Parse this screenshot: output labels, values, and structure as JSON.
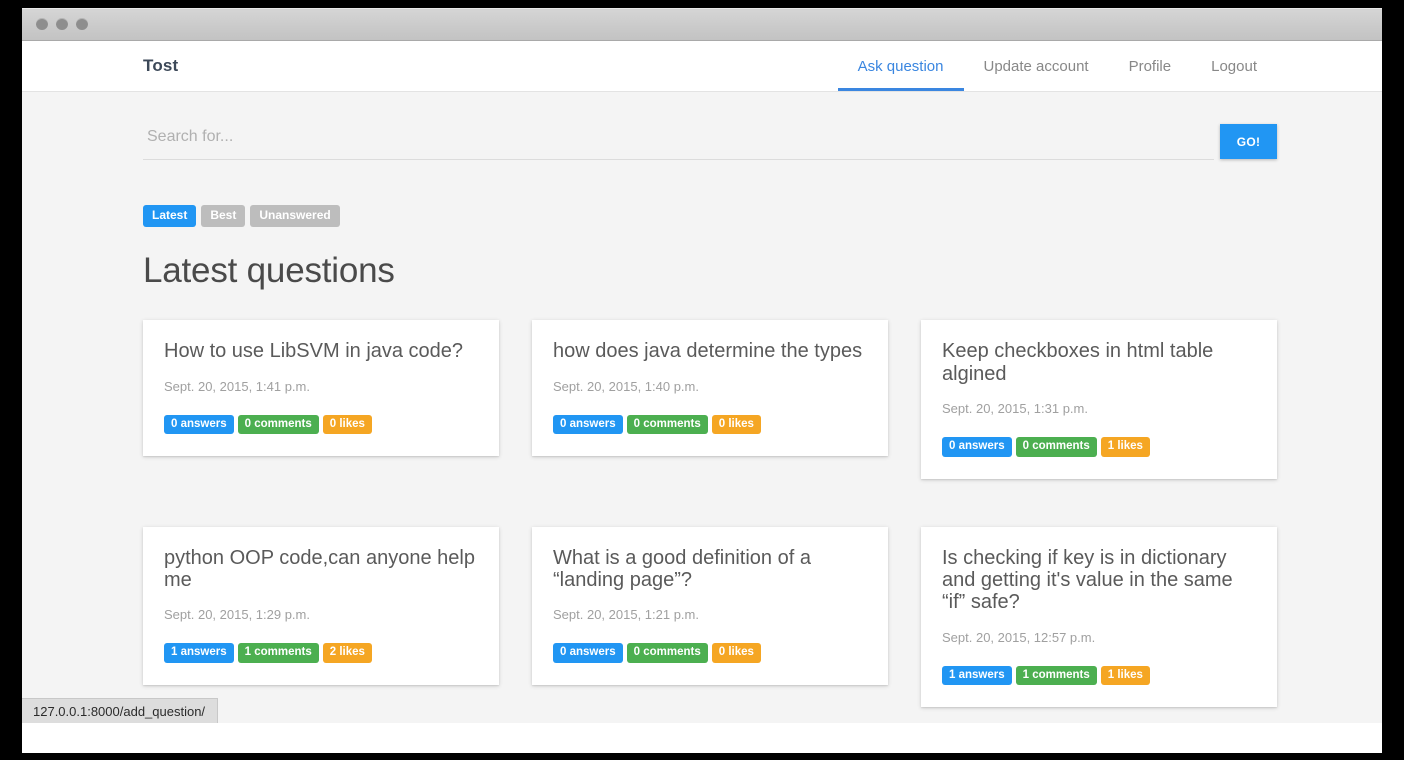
{
  "browser": {
    "window_controls": [
      "close",
      "minimize",
      "maximize"
    ],
    "status_bar_url": "127.0.0.1:8000/add_question/"
  },
  "navbar": {
    "brand": "Tost",
    "links": [
      {
        "label": "Ask question",
        "active": true
      },
      {
        "label": "Update account",
        "active": false
      },
      {
        "label": "Profile",
        "active": false
      },
      {
        "label": "Logout",
        "active": false
      }
    ]
  },
  "search": {
    "placeholder": "Search for...",
    "value": "",
    "button_label": "GO!"
  },
  "filters": [
    {
      "label": "Latest",
      "active": true
    },
    {
      "label": "Best",
      "active": false
    },
    {
      "label": "Unanswered",
      "active": false
    }
  ],
  "heading": "Latest questions",
  "questions": [
    {
      "title": "How to use LibSVM in java code?",
      "date": "Sept. 20, 2015, 1:41 p.m.",
      "answers": "0 answers",
      "comments": "0 comments",
      "likes": "0 likes"
    },
    {
      "title": "how does java determine the types",
      "date": "Sept. 20, 2015, 1:40 p.m.",
      "answers": "0 answers",
      "comments": "0 comments",
      "likes": "0 likes"
    },
    {
      "title": "Keep checkboxes in html table algined",
      "date": "Sept. 20, 2015, 1:31 p.m.",
      "answers": "0 answers",
      "comments": "0 comments",
      "likes": "1 likes"
    },
    {
      "title": "python OOP code,can anyone help me",
      "date": "Sept. 20, 2015, 1:29 p.m.",
      "answers": "1 answers",
      "comments": "1 comments",
      "likes": "2 likes"
    },
    {
      "title": "What is a good definition of a “landing page”?",
      "date": "Sept. 20, 2015, 1:21 p.m.",
      "answers": "0 answers",
      "comments": "0 comments",
      "likes": "0 likes"
    },
    {
      "title": "Is checking if key is in dictionary and getting it's value in the same “if” safe?",
      "date": "Sept. 20, 2015, 12:57 p.m.",
      "answers": "1 answers",
      "comments": "1 comments",
      "likes": "1 likes"
    }
  ],
  "colors": {
    "accent_blue": "#2196f3",
    "green": "#4caf50",
    "orange": "#f5a623",
    "gray_pill": "#bdbdbd",
    "page_bg": "#f4f4f4",
    "nav_active": "#3a86e0"
  }
}
